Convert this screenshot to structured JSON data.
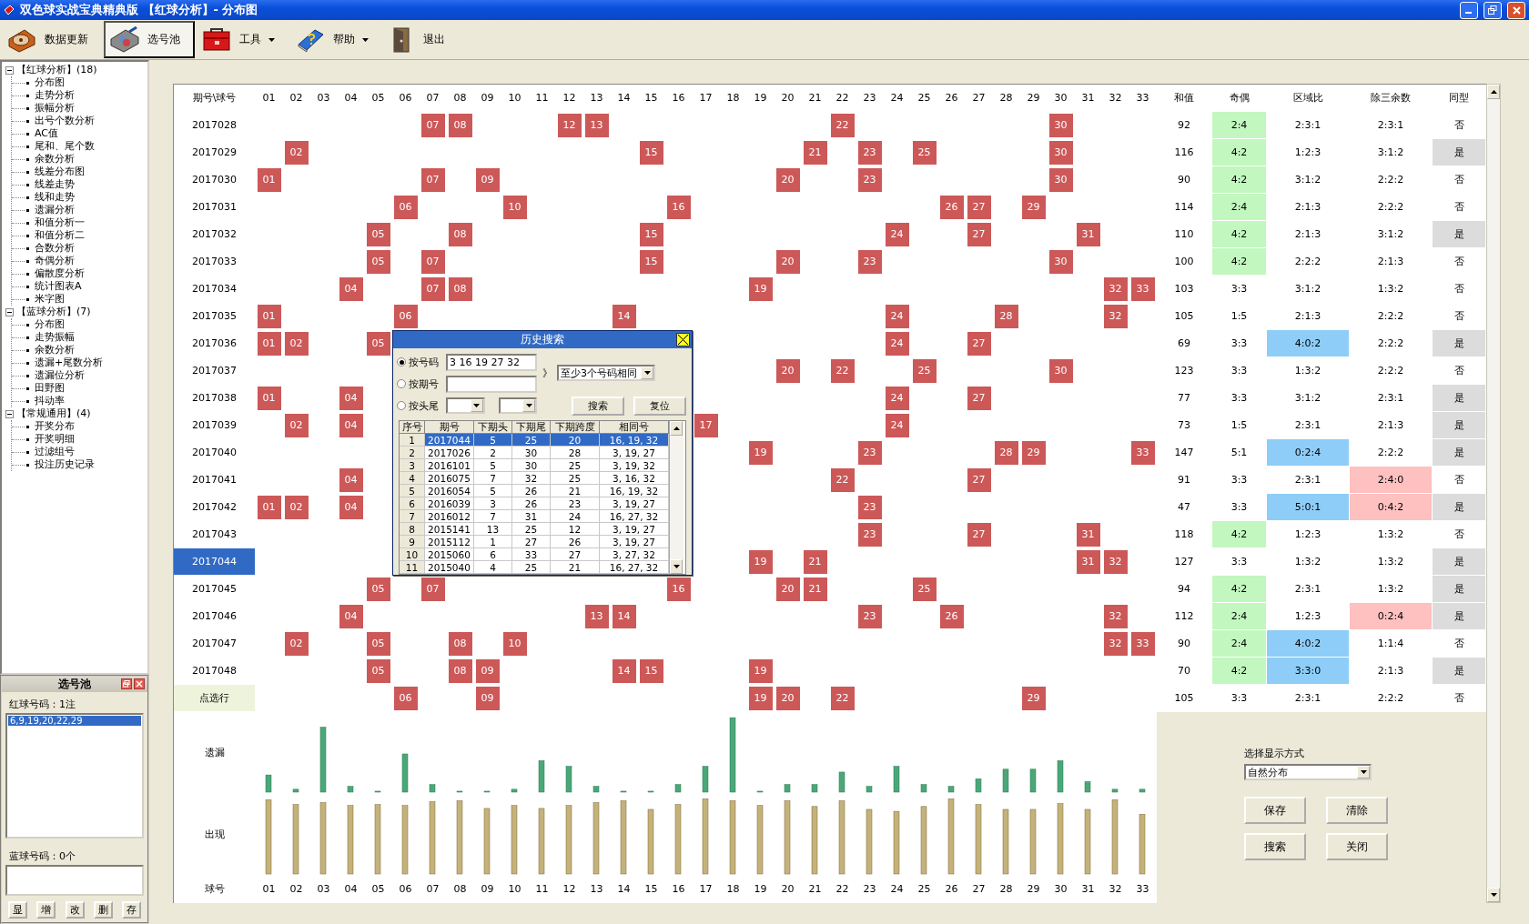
{
  "window": {
    "title": "双色球实战宝典精典版 【红球分析】- 分布图"
  },
  "toolbar": [
    {
      "label": "数据更新",
      "kind": "update",
      "pressed": false,
      "menu": false
    },
    {
      "label": "选号池",
      "kind": "pool",
      "pressed": true,
      "menu": false
    },
    {
      "label": "工具",
      "kind": "tools",
      "pressed": false,
      "menu": true
    },
    {
      "label": "帮助",
      "kind": "help",
      "pressed": false,
      "menu": true
    },
    {
      "label": "退出",
      "kind": "exit",
      "pressed": false,
      "menu": false
    }
  ],
  "tree": [
    {
      "label": "【红球分析】(18)",
      "expanded": true,
      "children": [
        {
          "label": "分布图"
        },
        {
          "label": "走势分析"
        },
        {
          "label": "振幅分析"
        },
        {
          "label": "出号个数分析"
        },
        {
          "label": "AC值"
        },
        {
          "label": "尾和、尾个数"
        },
        {
          "label": "余数分析"
        },
        {
          "label": "线差分布图"
        },
        {
          "label": "线差走势"
        },
        {
          "label": "线和走势"
        },
        {
          "label": "遗漏分析"
        },
        {
          "label": "和值分析一"
        },
        {
          "label": "和值分析二"
        },
        {
          "label": "合数分析"
        },
        {
          "label": "奇偶分析"
        },
        {
          "label": "偏散度分析"
        },
        {
          "label": "统计图表A"
        },
        {
          "label": "米字图"
        }
      ]
    },
    {
      "label": "【蓝球分析】(7)",
      "expanded": true,
      "children": [
        {
          "label": "分布图"
        },
        {
          "label": "走势振幅"
        },
        {
          "label": "余数分析"
        },
        {
          "label": "遗漏+尾数分析"
        },
        {
          "label": "遗漏位分析"
        },
        {
          "label": "田野图"
        },
        {
          "label": "抖动率"
        }
      ]
    },
    {
      "label": "【常规通用】(4)",
      "expanded": true,
      "children": [
        {
          "label": "开奖分布"
        },
        {
          "label": "开奖明细"
        },
        {
          "label": "过滤组号"
        },
        {
          "label": "投注历史记录"
        }
      ]
    }
  ],
  "pool": {
    "title": "选号池",
    "red_label": "红球号码：1注",
    "red_items": [
      {
        "text": "6,9,19,20,22,29",
        "selected": true
      }
    ],
    "blue_label": "蓝球号码：0个",
    "buttons": [
      "显",
      "增",
      "改",
      "删",
      "存"
    ]
  },
  "grid": {
    "corner": "期号\\球号",
    "ball_headers": [
      "01",
      "02",
      "03",
      "04",
      "05",
      "06",
      "07",
      "08",
      "09",
      "10",
      "11",
      "12",
      "13",
      "14",
      "15",
      "16",
      "17",
      "18",
      "19",
      "20",
      "21",
      "22",
      "23",
      "24",
      "25",
      "26",
      "27",
      "28",
      "29",
      "30",
      "31",
      "32",
      "33"
    ],
    "stat_headers": [
      "和值",
      "奇偶",
      "区域比",
      "除三余数",
      "同型"
    ],
    "rows": [
      {
        "issue": "2017028",
        "kind": "draw",
        "selected": false,
        "balls": [
          "07",
          "08",
          "12",
          "13",
          "22",
          "30"
        ],
        "sum": "92",
        "stats": [
          {
            "text": "2:4",
            "highlighted": true
          },
          {
            "text": "2:3:1",
            "highlighted": false
          },
          {
            "text": "2:3:1",
            "highlighted": false
          },
          {
            "text": "否",
            "highlighted": false
          }
        ]
      },
      {
        "issue": "2017029",
        "kind": "draw",
        "selected": false,
        "balls": [
          "02",
          "15",
          "21",
          "23",
          "25",
          "30"
        ],
        "sum": "116",
        "stats": [
          {
            "text": "4:2",
            "highlighted": true
          },
          {
            "text": "1:2:3",
            "highlighted": false
          },
          {
            "text": "3:1:2",
            "highlighted": false
          },
          {
            "text": "是",
            "highlighted": true
          }
        ]
      },
      {
        "issue": "2017030",
        "kind": "draw",
        "selected": false,
        "balls": [
          "01",
          "07",
          "09",
          "20",
          "23",
          "30"
        ],
        "sum": "90",
        "stats": [
          {
            "text": "4:2",
            "highlighted": true
          },
          {
            "text": "3:1:2",
            "highlighted": false
          },
          {
            "text": "2:2:2",
            "highlighted": false
          },
          {
            "text": "否",
            "highlighted": false
          }
        ]
      },
      {
        "issue": "2017031",
        "kind": "draw",
        "selected": false,
        "balls": [
          "06",
          "10",
          "16",
          "26",
          "27",
          "29"
        ],
        "sum": "114",
        "stats": [
          {
            "text": "2:4",
            "highlighted": true
          },
          {
            "text": "2:1:3",
            "highlighted": false
          },
          {
            "text": "2:2:2",
            "highlighted": false
          },
          {
            "text": "否",
            "highlighted": false
          }
        ]
      },
      {
        "issue": "2017032",
        "kind": "draw",
        "selected": false,
        "balls": [
          "05",
          "08",
          "15",
          "24",
          "27",
          "31"
        ],
        "sum": "110",
        "stats": [
          {
            "text": "4:2",
            "highlighted": true
          },
          {
            "text": "2:1:3",
            "highlighted": false
          },
          {
            "text": "3:1:2",
            "highlighted": false
          },
          {
            "text": "是",
            "highlighted": true
          }
        ]
      },
      {
        "issue": "2017033",
        "kind": "draw",
        "selected": false,
        "balls": [
          "05",
          "07",
          "15",
          "20",
          "23",
          "30"
        ],
        "sum": "100",
        "stats": [
          {
            "text": "4:2",
            "highlighted": true
          },
          {
            "text": "2:2:2",
            "highlighted": false
          },
          {
            "text": "2:1:3",
            "highlighted": false
          },
          {
            "text": "否",
            "highlighted": false
          }
        ]
      },
      {
        "issue": "2017034",
        "kind": "draw",
        "selected": false,
        "balls": [
          "04",
          "07",
          "08",
          "19",
          "32",
          "33"
        ],
        "sum": "103",
        "stats": [
          {
            "text": "3:3",
            "highlighted": false
          },
          {
            "text": "3:1:2",
            "highlighted": false
          },
          {
            "text": "1:3:2",
            "highlighted": false
          },
          {
            "text": "否",
            "highlighted": false
          }
        ]
      },
      {
        "issue": "2017035",
        "kind": "draw",
        "selected": false,
        "balls": [
          "01",
          "06",
          "14",
          "24",
          "28",
          "32"
        ],
        "sum": "105",
        "stats": [
          {
            "text": "1:5",
            "highlighted": false
          },
          {
            "text": "2:1:3",
            "highlighted": false
          },
          {
            "text": "2:2:2",
            "highlighted": false
          },
          {
            "text": "否",
            "highlighted": false
          }
        ]
      },
      {
        "issue": "2017036",
        "kind": "draw",
        "selected": false,
        "balls": [
          "01",
          "02",
          "05",
          "24",
          "27"
        ],
        "sum": "69",
        "stats": [
          {
            "text": "3:3",
            "highlighted": false
          },
          {
            "text": "4:0:2",
            "highlighted": true
          },
          {
            "text": "2:2:2",
            "highlighted": false
          },
          {
            "text": "是",
            "highlighted": true
          }
        ]
      },
      {
        "issue": "2017037",
        "kind": "draw",
        "selected": false,
        "balls": [
          "20",
          "22",
          "25",
          "30"
        ],
        "sum": "123",
        "stats": [
          {
            "text": "3:3",
            "highlighted": false
          },
          {
            "text": "1:3:2",
            "highlighted": false
          },
          {
            "text": "2:2:2",
            "highlighted": false
          },
          {
            "text": "否",
            "highlighted": false
          }
        ]
      },
      {
        "issue": "2017038",
        "kind": "draw",
        "selected": false,
        "balls": [
          "01",
          "04",
          "24",
          "27"
        ],
        "sum": "77",
        "stats": [
          {
            "text": "3:3",
            "highlighted": false
          },
          {
            "text": "3:1:2",
            "highlighted": false
          },
          {
            "text": "2:3:1",
            "highlighted": false
          },
          {
            "text": "是",
            "highlighted": true
          }
        ]
      },
      {
        "issue": "2017039",
        "kind": "draw",
        "selected": false,
        "balls": [
          "02",
          "04",
          "17",
          "24"
        ],
        "sum": "73",
        "stats": [
          {
            "text": "1:5",
            "highlighted": false
          },
          {
            "text": "2:3:1",
            "highlighted": false
          },
          {
            "text": "2:1:3",
            "highlighted": false
          },
          {
            "text": "是",
            "highlighted": true
          }
        ]
      },
      {
        "issue": "2017040",
        "kind": "draw",
        "selected": false,
        "balls": [
          "19",
          "23",
          "28",
          "29",
          "33"
        ],
        "sum": "147",
        "stats": [
          {
            "text": "5:1",
            "highlighted": false
          },
          {
            "text": "0:2:4",
            "highlighted": true
          },
          {
            "text": "2:2:2",
            "highlighted": false
          },
          {
            "text": "是",
            "highlighted": true
          }
        ]
      },
      {
        "issue": "2017041",
        "kind": "draw",
        "selected": false,
        "balls": [
          "04",
          "22",
          "27"
        ],
        "sum": "91",
        "stats": [
          {
            "text": "3:3",
            "highlighted": false
          },
          {
            "text": "2:3:1",
            "highlighted": false
          },
          {
            "text": "2:4:0",
            "highlighted": true
          },
          {
            "text": "否",
            "highlighted": false
          }
        ]
      },
      {
        "issue": "2017042",
        "kind": "draw",
        "selected": false,
        "balls": [
          "01",
          "02",
          "04",
          "23"
        ],
        "sum": "47",
        "stats": [
          {
            "text": "3:3",
            "highlighted": false
          },
          {
            "text": "5:0:1",
            "highlighted": true
          },
          {
            "text": "0:4:2",
            "highlighted": true
          },
          {
            "text": "是",
            "highlighted": true
          }
        ]
      },
      {
        "issue": "2017043",
        "kind": "draw",
        "selected": false,
        "balls": [
          "23",
          "27",
          "31"
        ],
        "sum": "118",
        "stats": [
          {
            "text": "4:2",
            "highlighted": true
          },
          {
            "text": "1:2:3",
            "highlighted": false
          },
          {
            "text": "1:3:2",
            "highlighted": false
          },
          {
            "text": "否",
            "highlighted": false
          }
        ]
      },
      {
        "issue": "2017044",
        "kind": "draw",
        "selected": true,
        "balls": [
          "19",
          "21",
          "31",
          "32"
        ],
        "sum": "127",
        "stats": [
          {
            "text": "3:3",
            "highlighted": false
          },
          {
            "text": "1:3:2",
            "highlighted": false
          },
          {
            "text": "1:3:2",
            "highlighted": false
          },
          {
            "text": "是",
            "highlighted": true
          }
        ]
      },
      {
        "issue": "2017045",
        "kind": "draw",
        "selected": false,
        "balls": [
          "05",
          "07",
          "16",
          "20",
          "21",
          "25"
        ],
        "sum": "94",
        "stats": [
          {
            "text": "4:2",
            "highlighted": true
          },
          {
            "text": "2:3:1",
            "highlighted": false
          },
          {
            "text": "1:3:2",
            "highlighted": false
          },
          {
            "text": "是",
            "highlighted": true
          }
        ]
      },
      {
        "issue": "2017046",
        "kind": "draw",
        "selected": false,
        "balls": [
          "04",
          "13",
          "14",
          "23",
          "26",
          "32"
        ],
        "sum": "112",
        "stats": [
          {
            "text": "2:4",
            "highlighted": true
          },
          {
            "text": "1:2:3",
            "highlighted": false
          },
          {
            "text": "0:2:4",
            "highlighted": true
          },
          {
            "text": "是",
            "highlighted": true
          }
        ]
      },
      {
        "issue": "2017047",
        "kind": "draw",
        "selected": false,
        "balls": [
          "02",
          "05",
          "08",
          "10",
          "32",
          "33"
        ],
        "sum": "90",
        "stats": [
          {
            "text": "2:4",
            "highlighted": true
          },
          {
            "text": "4:0:2",
            "highlighted": true
          },
          {
            "text": "1:1:4",
            "highlighted": false
          },
          {
            "text": "否",
            "highlighted": false
          }
        ]
      },
      {
        "issue": "2017048",
        "kind": "draw",
        "selected": false,
        "balls": [
          "05",
          "08",
          "09",
          "14",
          "15",
          "19"
        ],
        "sum": "70",
        "stats": [
          {
            "text": "4:2",
            "highlighted": true
          },
          {
            "text": "3:3:0",
            "highlighted": true
          },
          {
            "text": "2:1:3",
            "highlighted": false
          },
          {
            "text": "是",
            "highlighted": true
          }
        ]
      },
      {
        "issue": "点选行",
        "kind": "pick",
        "selected": false,
        "balls": [
          "06",
          "09",
          "19",
          "20",
          "22",
          "29"
        ],
        "sum": "105",
        "stats": [
          {
            "text": "3:3",
            "highlighted": false
          },
          {
            "text": "2:3:1",
            "highlighted": false
          },
          {
            "text": "2:2:2",
            "highlighted": false
          },
          {
            "text": "否",
            "highlighted": false
          }
        ]
      }
    ],
    "omission_label": "遗漏",
    "occurrence_label": "出现",
    "footer_label": "球号",
    "footer_balls": [
      "01",
      "02",
      "03",
      "04",
      "05",
      "06",
      "07",
      "08",
      "09",
      "10",
      "11",
      "12",
      "13",
      "14",
      "15",
      "16",
      "17",
      "18",
      "19",
      "20",
      "21",
      "22",
      "23",
      "24",
      "25",
      "26",
      "27",
      "28",
      "29",
      "30",
      "31",
      "32",
      "33"
    ]
  },
  "display": {
    "label": "选择显示方式",
    "mode": "自然分布",
    "buttons": [
      "保存",
      "清除",
      "搜索",
      "关闭"
    ]
  },
  "dialog": {
    "title": "历史搜索",
    "options": [
      {
        "label": "按号码",
        "selected": true,
        "kind": "text",
        "value": "3 16 19 27 32"
      },
      {
        "label": "按期号",
        "selected": false,
        "kind": "text"
      },
      {
        "label": "按头尾",
        "selected": false,
        "kind": "pair"
      }
    ],
    "arrow": "》",
    "match": "至少3个号码相同",
    "buttons": [
      "搜索",
      "复位"
    ],
    "columns": [
      "序号",
      "期号",
      "下期头",
      "下期尾",
      "下期跨度",
      "相同号"
    ],
    "results": [
      {
        "cells": [
          "1",
          "2017044",
          "5",
          "25",
          "20",
          "16, 19, 32"
        ],
        "selected": true
      },
      {
        "cells": [
          "2",
          "2017026",
          "2",
          "30",
          "28",
          "3, 19, 27"
        ],
        "selected": false
      },
      {
        "cells": [
          "3",
          "2016101",
          "5",
          "30",
          "25",
          "3, 19, 32"
        ],
        "selected": false
      },
      {
        "cells": [
          "4",
          "2016075",
          "7",
          "32",
          "25",
          "3, 16, 32"
        ],
        "selected": false
      },
      {
        "cells": [
          "5",
          "2016054",
          "5",
          "26",
          "21",
          "16, 19, 32"
        ],
        "selected": false
      },
      {
        "cells": [
          "6",
          "2016039",
          "3",
          "26",
          "23",
          "3, 19, 27"
        ],
        "selected": false
      },
      {
        "cells": [
          "7",
          "2016012",
          "7",
          "31",
          "24",
          "16, 27, 32"
        ],
        "selected": false
      },
      {
        "cells": [
          "8",
          "2015141",
          "13",
          "25",
          "12",
          "3, 19, 27"
        ],
        "selected": false
      },
      {
        "cells": [
          "9",
          "2015112",
          "1",
          "27",
          "26",
          "3, 19, 27"
        ],
        "selected": false
      },
      {
        "cells": [
          "10",
          "2015060",
          "6",
          "33",
          "27",
          "3, 27, 32"
        ],
        "selected": false
      },
      {
        "cells": [
          "11",
          "2015040",
          "4",
          "25",
          "21",
          "16, 27, 32"
        ],
        "selected": false
      }
    ]
  }
}
